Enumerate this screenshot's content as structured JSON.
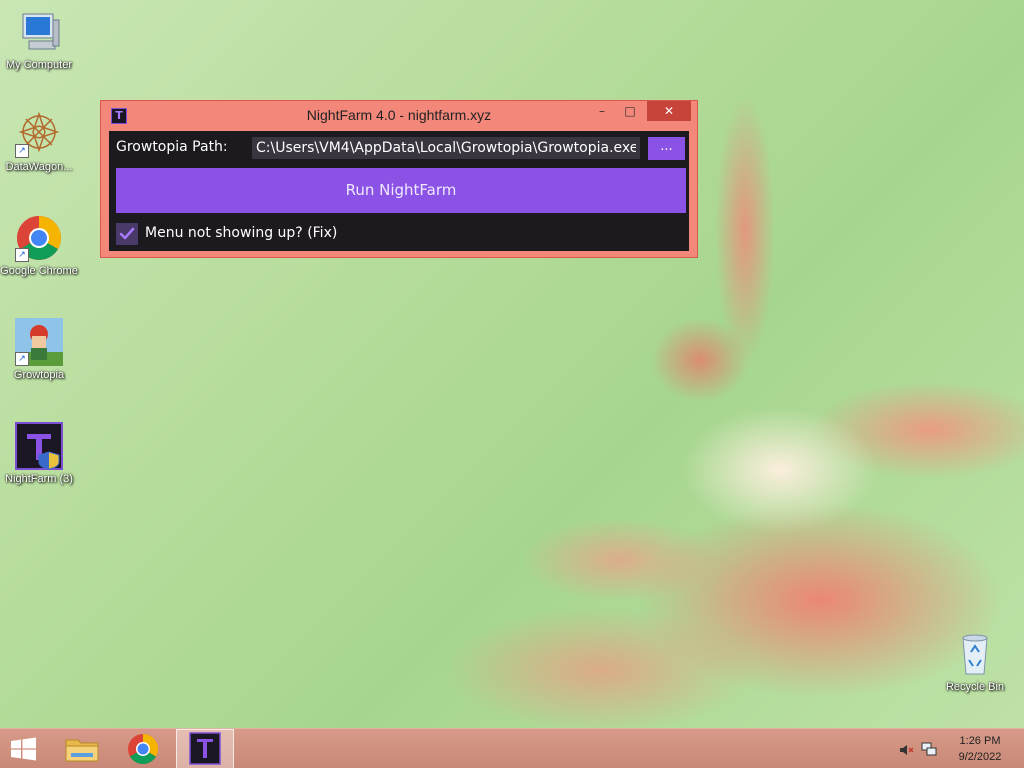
{
  "desktop": {
    "icons": [
      {
        "label": "My Computer",
        "icon": "computer-icon"
      },
      {
        "label": "DataWagon...",
        "icon": "datawagon-icon"
      },
      {
        "label": "Google Chrome",
        "icon": "chrome-icon"
      },
      {
        "label": "Growtopia",
        "icon": "growtopia-icon"
      },
      {
        "label": "NightFarm (3)",
        "icon": "nightfarm-icon"
      },
      {
        "label": "Recycle Bin",
        "icon": "recycle-bin-icon"
      }
    ]
  },
  "window": {
    "title": "NightFarm 4.0 - nightfarm.xyz",
    "minimize": "–",
    "maximize": "□",
    "close": "✕",
    "icon_letter": "T",
    "path_label": "Growtopia Path:",
    "path_value": "C:\\Users\\VM4\\AppData\\Local\\Growtopia\\Growtopia.exe",
    "browse_label": "...",
    "run_label": "Run NightFarm",
    "fix_label": "Menu not showing up? (Fix)",
    "fix_checked": true,
    "accent_color": "#8b52e6",
    "frame_color": "#f3877a"
  },
  "taskbar": {
    "items": [
      "start-button",
      "file-explorer",
      "google-chrome",
      "nightfarm"
    ],
    "active": "nightfarm",
    "tray": {
      "speaker": "speaker-muted-icon",
      "network": "network-icon"
    },
    "clock": {
      "time": "1:26 PM",
      "date": "9/2/2022"
    }
  }
}
